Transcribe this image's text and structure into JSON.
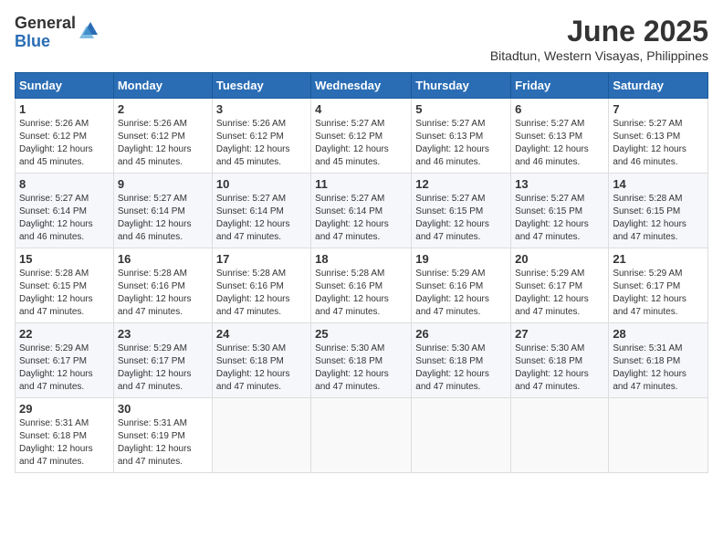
{
  "logo": {
    "general": "General",
    "blue": "Blue"
  },
  "title": "June 2025",
  "subtitle": "Bitadtun, Western Visayas, Philippines",
  "days_of_week": [
    "Sunday",
    "Monday",
    "Tuesday",
    "Wednesday",
    "Thursday",
    "Friday",
    "Saturday"
  ],
  "weeks": [
    [
      {
        "day": "1",
        "sunrise": "5:26 AM",
        "sunset": "6:12 PM",
        "daylight": "12 hours and 45 minutes."
      },
      {
        "day": "2",
        "sunrise": "5:26 AM",
        "sunset": "6:12 PM",
        "daylight": "12 hours and 45 minutes."
      },
      {
        "day": "3",
        "sunrise": "5:26 AM",
        "sunset": "6:12 PM",
        "daylight": "12 hours and 45 minutes."
      },
      {
        "day": "4",
        "sunrise": "5:27 AM",
        "sunset": "6:12 PM",
        "daylight": "12 hours and 45 minutes."
      },
      {
        "day": "5",
        "sunrise": "5:27 AM",
        "sunset": "6:13 PM",
        "daylight": "12 hours and 46 minutes."
      },
      {
        "day": "6",
        "sunrise": "5:27 AM",
        "sunset": "6:13 PM",
        "daylight": "12 hours and 46 minutes."
      },
      {
        "day": "7",
        "sunrise": "5:27 AM",
        "sunset": "6:13 PM",
        "daylight": "12 hours and 46 minutes."
      }
    ],
    [
      {
        "day": "8",
        "sunrise": "5:27 AM",
        "sunset": "6:14 PM",
        "daylight": "12 hours and 46 minutes."
      },
      {
        "day": "9",
        "sunrise": "5:27 AM",
        "sunset": "6:14 PM",
        "daylight": "12 hours and 46 minutes."
      },
      {
        "day": "10",
        "sunrise": "5:27 AM",
        "sunset": "6:14 PM",
        "daylight": "12 hours and 47 minutes."
      },
      {
        "day": "11",
        "sunrise": "5:27 AM",
        "sunset": "6:14 PM",
        "daylight": "12 hours and 47 minutes."
      },
      {
        "day": "12",
        "sunrise": "5:27 AM",
        "sunset": "6:15 PM",
        "daylight": "12 hours and 47 minutes."
      },
      {
        "day": "13",
        "sunrise": "5:27 AM",
        "sunset": "6:15 PM",
        "daylight": "12 hours and 47 minutes."
      },
      {
        "day": "14",
        "sunrise": "5:28 AM",
        "sunset": "6:15 PM",
        "daylight": "12 hours and 47 minutes."
      }
    ],
    [
      {
        "day": "15",
        "sunrise": "5:28 AM",
        "sunset": "6:15 PM",
        "daylight": "12 hours and 47 minutes."
      },
      {
        "day": "16",
        "sunrise": "5:28 AM",
        "sunset": "6:16 PM",
        "daylight": "12 hours and 47 minutes."
      },
      {
        "day": "17",
        "sunrise": "5:28 AM",
        "sunset": "6:16 PM",
        "daylight": "12 hours and 47 minutes."
      },
      {
        "day": "18",
        "sunrise": "5:28 AM",
        "sunset": "6:16 PM",
        "daylight": "12 hours and 47 minutes."
      },
      {
        "day": "19",
        "sunrise": "5:29 AM",
        "sunset": "6:16 PM",
        "daylight": "12 hours and 47 minutes."
      },
      {
        "day": "20",
        "sunrise": "5:29 AM",
        "sunset": "6:17 PM",
        "daylight": "12 hours and 47 minutes."
      },
      {
        "day": "21",
        "sunrise": "5:29 AM",
        "sunset": "6:17 PM",
        "daylight": "12 hours and 47 minutes."
      }
    ],
    [
      {
        "day": "22",
        "sunrise": "5:29 AM",
        "sunset": "6:17 PM",
        "daylight": "12 hours and 47 minutes."
      },
      {
        "day": "23",
        "sunrise": "5:29 AM",
        "sunset": "6:17 PM",
        "daylight": "12 hours and 47 minutes."
      },
      {
        "day": "24",
        "sunrise": "5:30 AM",
        "sunset": "6:18 PM",
        "daylight": "12 hours and 47 minutes."
      },
      {
        "day": "25",
        "sunrise": "5:30 AM",
        "sunset": "6:18 PM",
        "daylight": "12 hours and 47 minutes."
      },
      {
        "day": "26",
        "sunrise": "5:30 AM",
        "sunset": "6:18 PM",
        "daylight": "12 hours and 47 minutes."
      },
      {
        "day": "27",
        "sunrise": "5:30 AM",
        "sunset": "6:18 PM",
        "daylight": "12 hours and 47 minutes."
      },
      {
        "day": "28",
        "sunrise": "5:31 AM",
        "sunset": "6:18 PM",
        "daylight": "12 hours and 47 minutes."
      }
    ],
    [
      {
        "day": "29",
        "sunrise": "5:31 AM",
        "sunset": "6:18 PM",
        "daylight": "12 hours and 47 minutes."
      },
      {
        "day": "30",
        "sunrise": "5:31 AM",
        "sunset": "6:19 PM",
        "daylight": "12 hours and 47 minutes."
      },
      null,
      null,
      null,
      null,
      null
    ]
  ]
}
